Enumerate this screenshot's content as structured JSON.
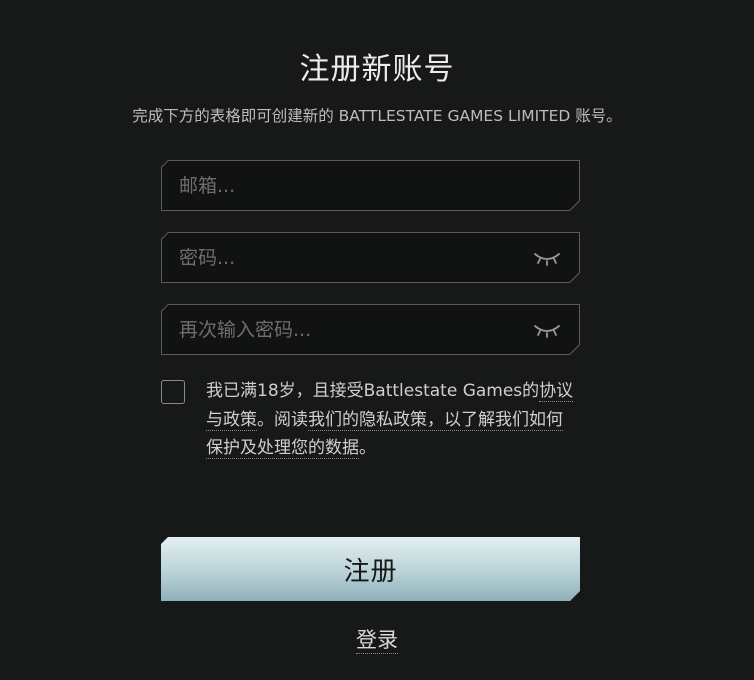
{
  "header": {
    "title": "注册新账号",
    "subtitle": "完成下方的表格即可创建新的 BATTLESTATE GAMES LIMITED 账号。"
  },
  "form": {
    "email": {
      "value": "",
      "placeholder": "邮箱..."
    },
    "password": {
      "value": "",
      "placeholder": "密码...",
      "toggle_icon": "eye-closed-icon"
    },
    "confirm_password": {
      "value": "",
      "placeholder": "再次输入密码...",
      "toggle_icon": "eye-closed-icon"
    }
  },
  "terms": {
    "checked": false,
    "text_before": "我已满18岁，且接受Battlestate Games的",
    "agreement_link": "协议与政策",
    "text_middle": "。阅读",
    "privacy_link": "我们的隐私政策，以了解我们如何保护及处理您的数据",
    "text_after": "。"
  },
  "actions": {
    "register_label": "注册",
    "login_label": "登录"
  },
  "colors": {
    "background": "#171818",
    "button_top": "#e3eff1",
    "button_bottom": "#8fb0b9"
  }
}
